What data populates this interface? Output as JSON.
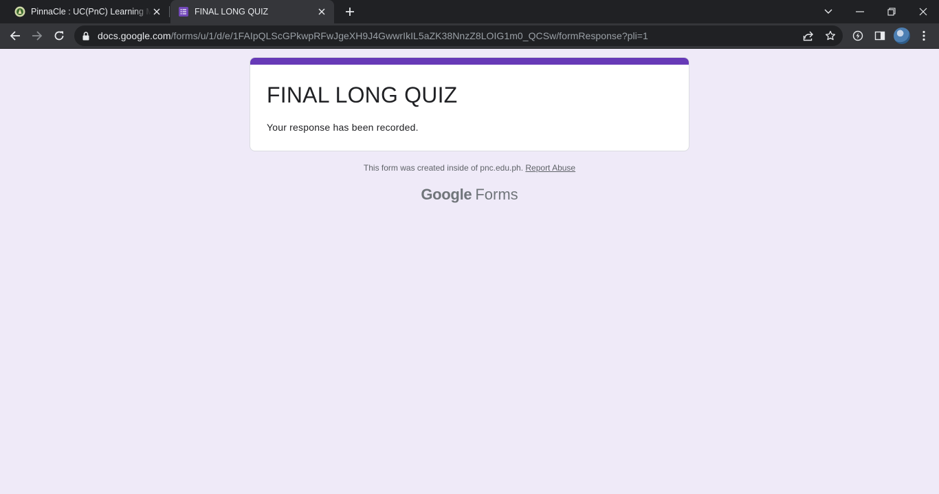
{
  "browser": {
    "tabs": [
      {
        "title": "PinnaCle : UC(PnC) Learning Management System",
        "active": false,
        "favicon": "pinnacle-icon"
      },
      {
        "title": "FINAL LONG QUIZ",
        "active": true,
        "favicon": "google-forms-icon"
      }
    ],
    "url_host": "docs.google.com",
    "url_path": "/forms/u/1/d/e/1FAIpQLScGPkwpRFwJgeXH9J4GwwrIkIL5aZK38NnzZ8LOIG1m0_QCSw/formResponse?pli=1"
  },
  "form": {
    "title": "FINAL LONG QUIZ",
    "confirmation": "Your response has been recorded.",
    "accent_color": "#673ab7"
  },
  "footer": {
    "note": "This form was created inside of pnc.edu.ph.",
    "report_link": "Report Abuse",
    "brand_google": "Google",
    "brand_forms": "Forms"
  }
}
